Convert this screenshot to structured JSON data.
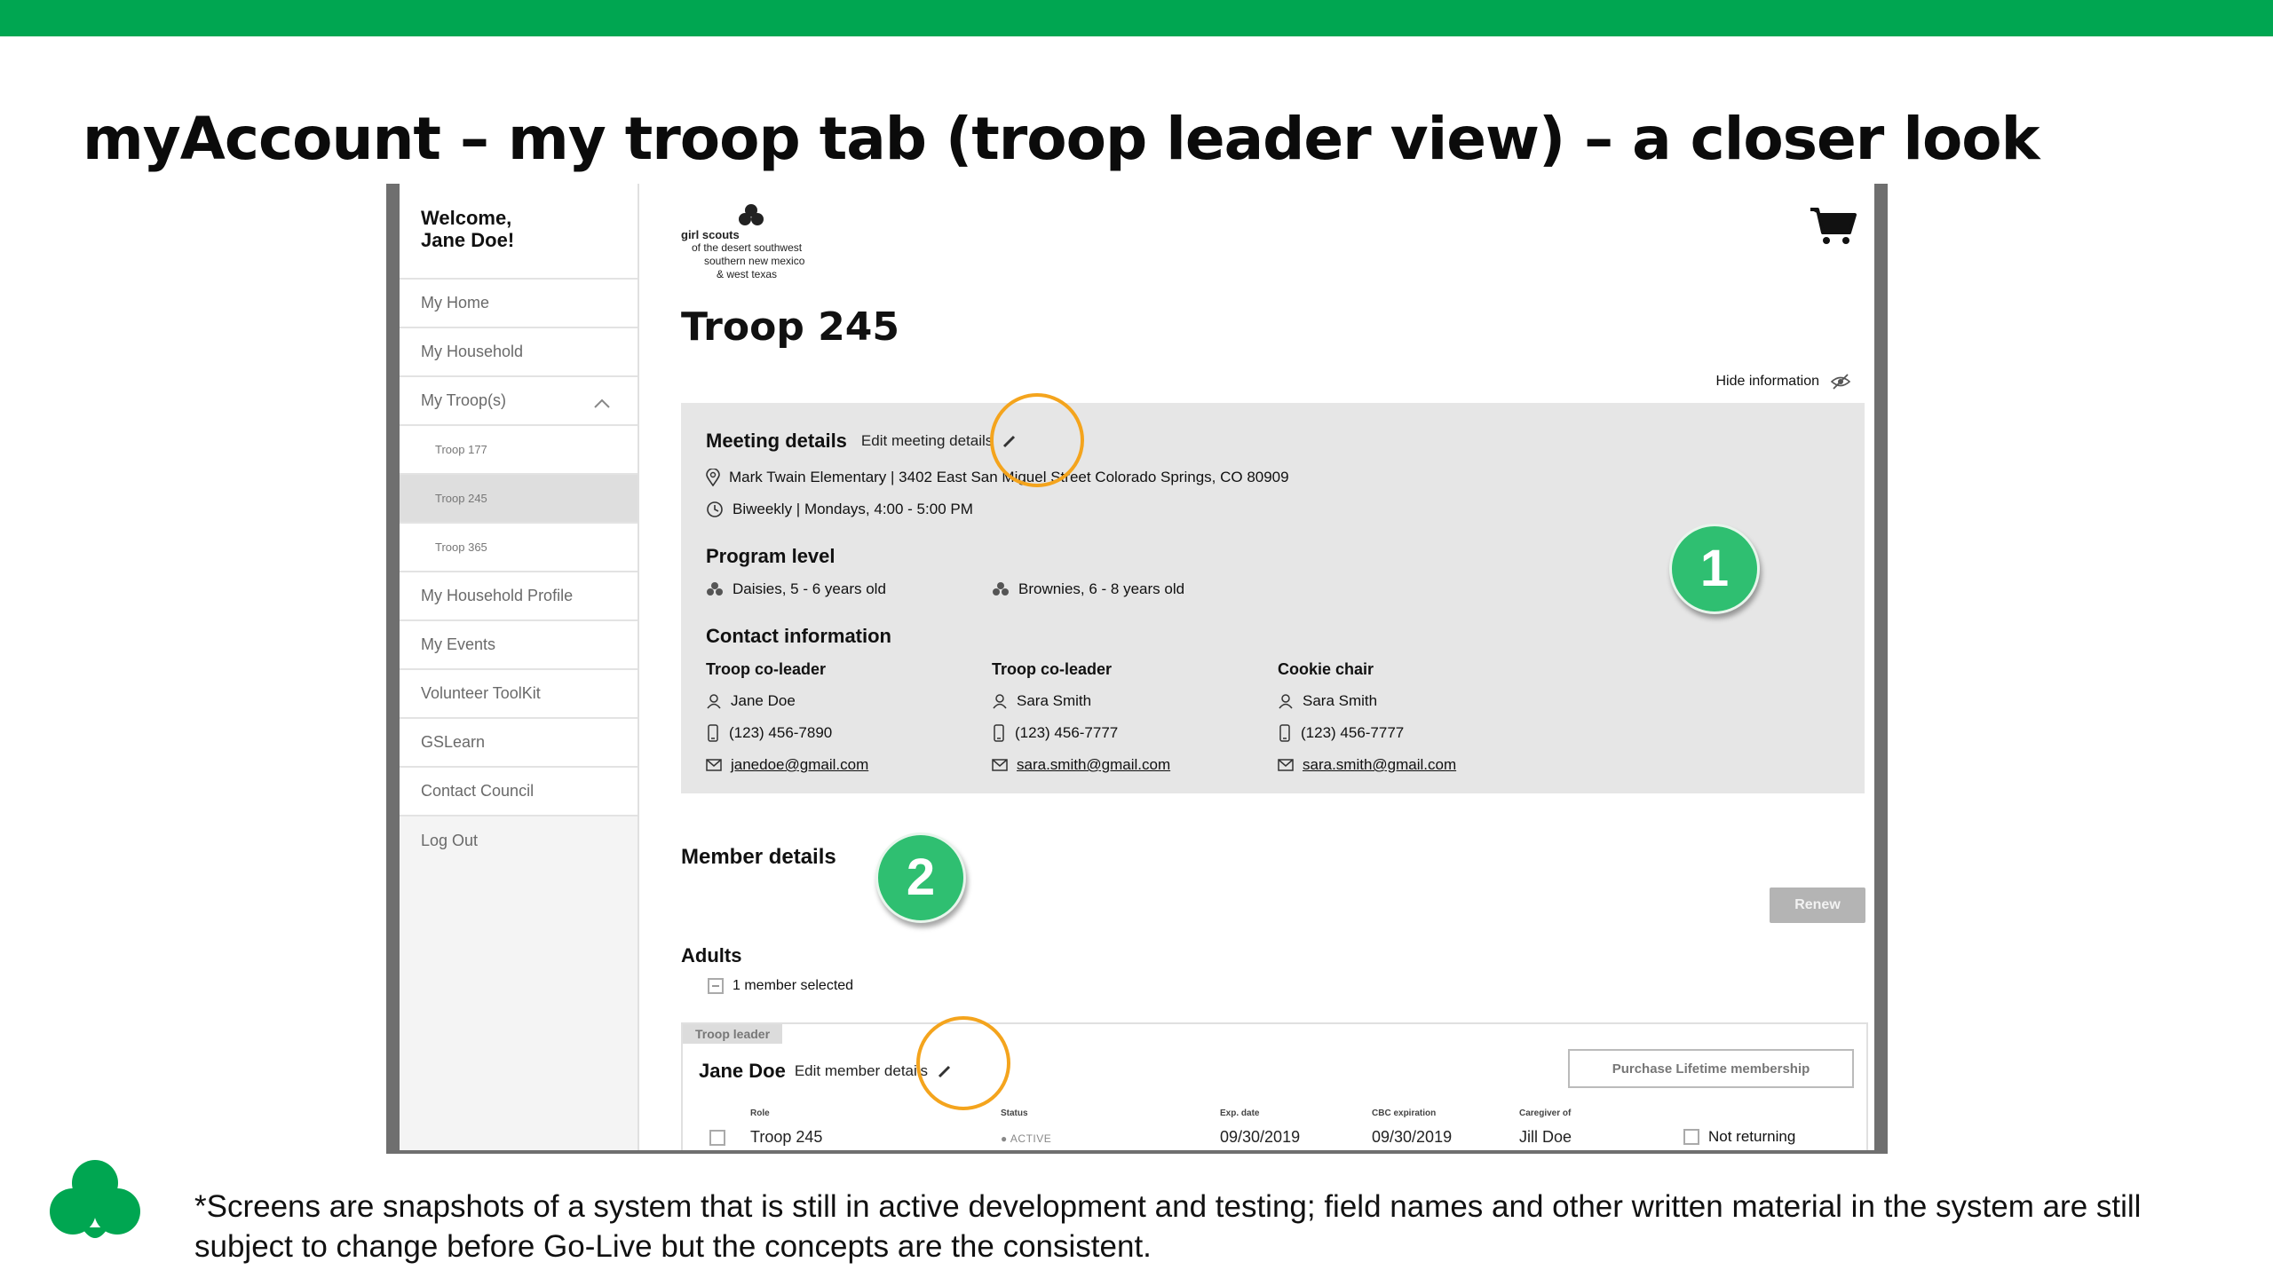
{
  "slide": {
    "title": "myAccount – my troop tab (troop leader view) – a closer look",
    "disclaimer": "*Screens are snapshots of a system that is still in active development and testing; field names and other written material in the system are still subject to change before Go-Live but the concepts are the consistent.",
    "accent_color": "#00a651"
  },
  "sidebar": {
    "welcome": "Welcome,\nJane Doe!",
    "items": [
      {
        "label": "My Home"
      },
      {
        "label": "My Household"
      },
      {
        "label": "My Troop(s)"
      },
      {
        "label": "Troop 177"
      },
      {
        "label": "Troop 245"
      },
      {
        "label": "Troop 365"
      },
      {
        "label": "My Household Profile"
      },
      {
        "label": "My Events"
      },
      {
        "label": "Volunteer ToolKit"
      },
      {
        "label": "GSLearn"
      },
      {
        "label": "Contact Council"
      },
      {
        "label": "Log Out"
      }
    ]
  },
  "logo": {
    "brand": "girl scouts",
    "line1": "of the desert southwest",
    "line2": "southern new mexico",
    "line3": "& west texas"
  },
  "troop": {
    "title": "Troop 245",
    "hide_information": "Hide information"
  },
  "meeting": {
    "heading": "Meeting details",
    "edit_label": "Edit meeting details",
    "address": "Mark Twain Elementary | 3402 East San Miguel Street Colorado Springs, CO 80909",
    "schedule": "Biweekly | Mondays, 4:00 - 5:00 PM"
  },
  "program": {
    "heading": "Program level",
    "levels": [
      "Daisies, 5 - 6 years old",
      "Brownies, 6 - 8 years old"
    ]
  },
  "contact": {
    "heading": "Contact information",
    "people": [
      {
        "role": "Troop co-leader",
        "name": "Jane Doe",
        "phone": "(123) 456-7890",
        "email": "janedoe@gmail.com"
      },
      {
        "role": "Troop co-leader",
        "name": "Sara Smith",
        "phone": "(123) 456-7777",
        "email": "sara.smith@gmail.com"
      },
      {
        "role": "Cookie chair",
        "name": "Sara Smith",
        "phone": "(123) 456-7777",
        "email": "sara.smith@gmail.com"
      }
    ]
  },
  "badges": {
    "one": "1",
    "two": "2"
  },
  "members": {
    "heading": "Member details",
    "renew_label": "Renew",
    "adults_heading": "Adults",
    "selected_text": "1 member selected",
    "card": {
      "tag": "Troop leader",
      "name": "Jane Doe",
      "edit_label": "Edit member details",
      "lifetime_label": "Purchase Lifetime membership",
      "headers": {
        "role": "Role",
        "status": "Status",
        "exp": "Exp. date",
        "cbc": "CBC expiration",
        "caregiver": "Caregiver of"
      },
      "row": {
        "role": "Troop 245",
        "status": "ACTIVE",
        "exp": "09/30/2019",
        "cbc": "09/30/2019",
        "caregiver": "Jill Doe",
        "not_returning": "Not returning"
      }
    }
  }
}
